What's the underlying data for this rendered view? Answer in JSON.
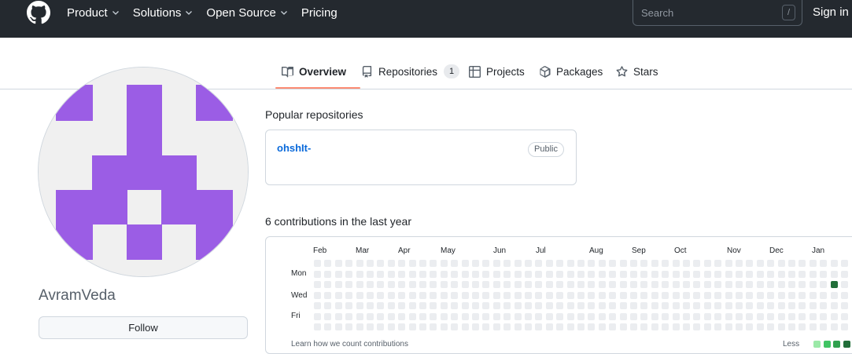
{
  "header": {
    "logo_icon": "github-octocat-icon",
    "nav": [
      {
        "label": "Product",
        "dropdown": true
      },
      {
        "label": "Solutions",
        "dropdown": true
      },
      {
        "label": "Open Source",
        "dropdown": true
      },
      {
        "label": "Pricing",
        "dropdown": false
      }
    ],
    "search": {
      "placeholder": "Search",
      "shortcut": "/"
    },
    "signin_label": "Sign in"
  },
  "tabs": [
    {
      "label": "Overview",
      "icon": "book-icon",
      "active": true
    },
    {
      "label": "Repositories",
      "icon": "repo-icon",
      "count": "1"
    },
    {
      "label": "Projects",
      "icon": "table-icon"
    },
    {
      "label": "Packages",
      "icon": "package-icon"
    },
    {
      "label": "Stars",
      "icon": "star-icon"
    }
  ],
  "profile": {
    "username": "AvramVeda",
    "follow_label": "Follow",
    "avatar_color": "#9b5de5"
  },
  "popular": {
    "title": "Popular repositories",
    "repos": [
      {
        "name": "ohshIt-",
        "visibility": "Public"
      }
    ]
  },
  "contributions": {
    "title": "6 contributions in the last year",
    "months": [
      "Feb",
      "Mar",
      "Apr",
      "May",
      "Jun",
      "Jul",
      "Aug",
      "Sep",
      "Oct",
      "Nov",
      "Dec",
      "Jan"
    ],
    "days": [
      "Mon",
      "Wed",
      "Fri"
    ],
    "legend_left": "Learn how we count contributions",
    "legend_less": "Less"
  },
  "colors": {
    "header_bg": "#24292f",
    "link": "#0969da",
    "tab_accent": "#fd8c73",
    "empty_cell": "#ebedf0",
    "level_1": "#9be9a8",
    "level_2": "#40c463",
    "level_3": "#30a14e",
    "level_4": "#216e39"
  }
}
